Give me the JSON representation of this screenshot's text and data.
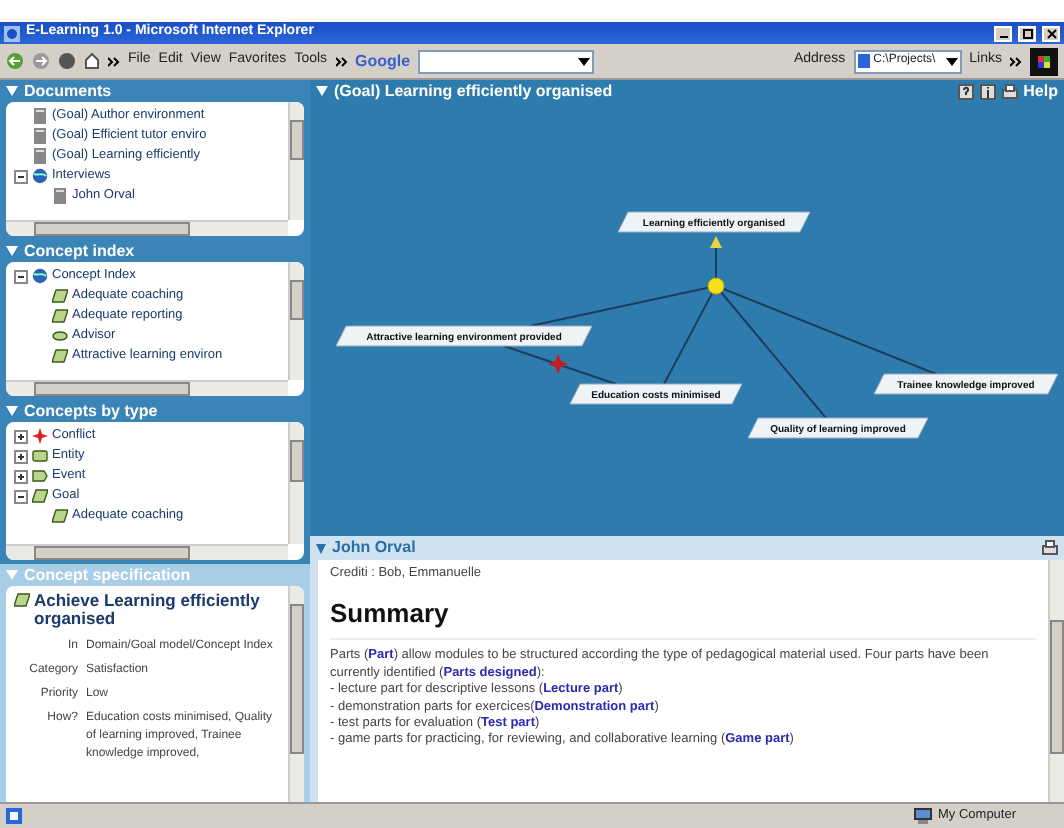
{
  "window": {
    "title": "E-Learning 1.0 - Microsoft Internet Explorer"
  },
  "toolbar": {
    "menus": [
      "File",
      "Edit",
      "View",
      "Favorites",
      "Tools"
    ],
    "search_label": "Google",
    "address_label": "Address",
    "address_value": "C:\\Projects\\",
    "links_label": "Links"
  },
  "documents": {
    "title": "Documents",
    "tree": [
      {
        "label": "(Goal) Author environment",
        "kind": "doc"
      },
      {
        "label": "(Goal) Efficient tutor enviro",
        "kind": "doc"
      },
      {
        "label": "(Goal) Learning efficiently",
        "kind": "doc"
      },
      {
        "label": "Interviews",
        "kind": "globe",
        "expanded": true,
        "children": [
          {
            "label": "John Orval",
            "kind": "doc"
          }
        ]
      }
    ]
  },
  "concept_index": {
    "title": "Concept index",
    "tree": [
      {
        "label": "Concept Index",
        "kind": "globe",
        "expanded": true,
        "children": [
          {
            "label": "Adequate coaching",
            "kind": "goal"
          },
          {
            "label": "Adequate reporting",
            "kind": "goal"
          },
          {
            "label": "Advisor",
            "kind": "actor"
          },
          {
            "label": "Attractive learning environ",
            "kind": "goal"
          }
        ]
      }
    ]
  },
  "concepts_by_type": {
    "title": "Concepts by type",
    "tree": [
      {
        "label": "Conflict",
        "kind": "conflict",
        "expanded": false
      },
      {
        "label": "Entity",
        "kind": "entity",
        "expanded": false
      },
      {
        "label": "Event",
        "kind": "event",
        "expanded": false
      },
      {
        "label": "Goal",
        "kind": "goal",
        "expanded": true,
        "children": [
          {
            "label": "Adequate coaching",
            "kind": "goal"
          }
        ]
      }
    ]
  },
  "concept_specification": {
    "title": "Concept specification",
    "concept": "Achieve Learning efficiently organised",
    "fields": [
      {
        "label": "In",
        "value": "Domain/Goal model/Concept Index"
      },
      {
        "label": "Category",
        "value": "Satisfaction"
      },
      {
        "label": "Priority",
        "value": "Low"
      },
      {
        "label": "How?",
        "value": "Education costs minimised, Quality of learning improved, Trainee knowledge improved,"
      }
    ]
  },
  "graph_panel": {
    "title": "(Goal) Learning efficiently organised",
    "help": "Help",
    "nodes": [
      {
        "label": "Learning efficiently organised"
      },
      {
        "label": "Attractive learning environment provided"
      },
      {
        "label": "Education costs minimised"
      },
      {
        "label": "Quality of learning improved"
      },
      {
        "label": "Trainee knowledge improved"
      }
    ]
  },
  "document_panel": {
    "title": "John Orval",
    "credits": "Crediti : Bob, Emmanuelle",
    "heading": "Summary",
    "paragraphs": [
      "Parts (**Part**) allow modules to be structured according the type of pedagogical material used. Four parts have been currently identified (**Parts designed**):",
      "- lecture part for descriptive lessons (**Lecture part**)",
      "- demonstration parts for exercices(**Demonstration part**)",
      "- test parts for evaluation (**Test part**)",
      "- game parts for practicing, for reviewing, and collaborative learning (**Game part**)"
    ]
  },
  "status_bar": {
    "zone": "My Computer"
  }
}
